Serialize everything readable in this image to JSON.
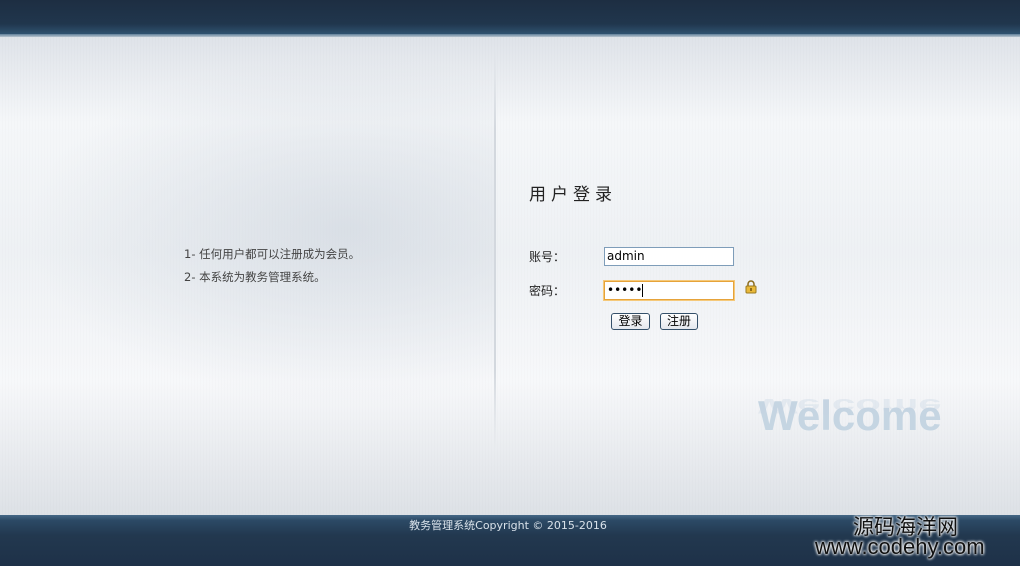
{
  "notes": [
    "1- 任何用户都可以注册成为会员。",
    "2- 本系统为教务管理系统。"
  ],
  "login": {
    "title": "用户登录",
    "username_label": "账号：",
    "username_value": "admin",
    "password_label": "密码：",
    "password_mask": "•••••",
    "login_button": "登录",
    "register_button": "注册"
  },
  "welcome_text": "Welcome",
  "footer": {
    "copyright": "教务管理系统Copyright © 2015-2016"
  },
  "watermark": {
    "line1": "源码海洋网",
    "line2": "www.codehy.com"
  },
  "icons": {
    "lock": "lock-icon"
  },
  "colors": {
    "header_bg": "#1d2e42",
    "footer_bg": "#22384f",
    "focus_border": "#e6a33a"
  }
}
